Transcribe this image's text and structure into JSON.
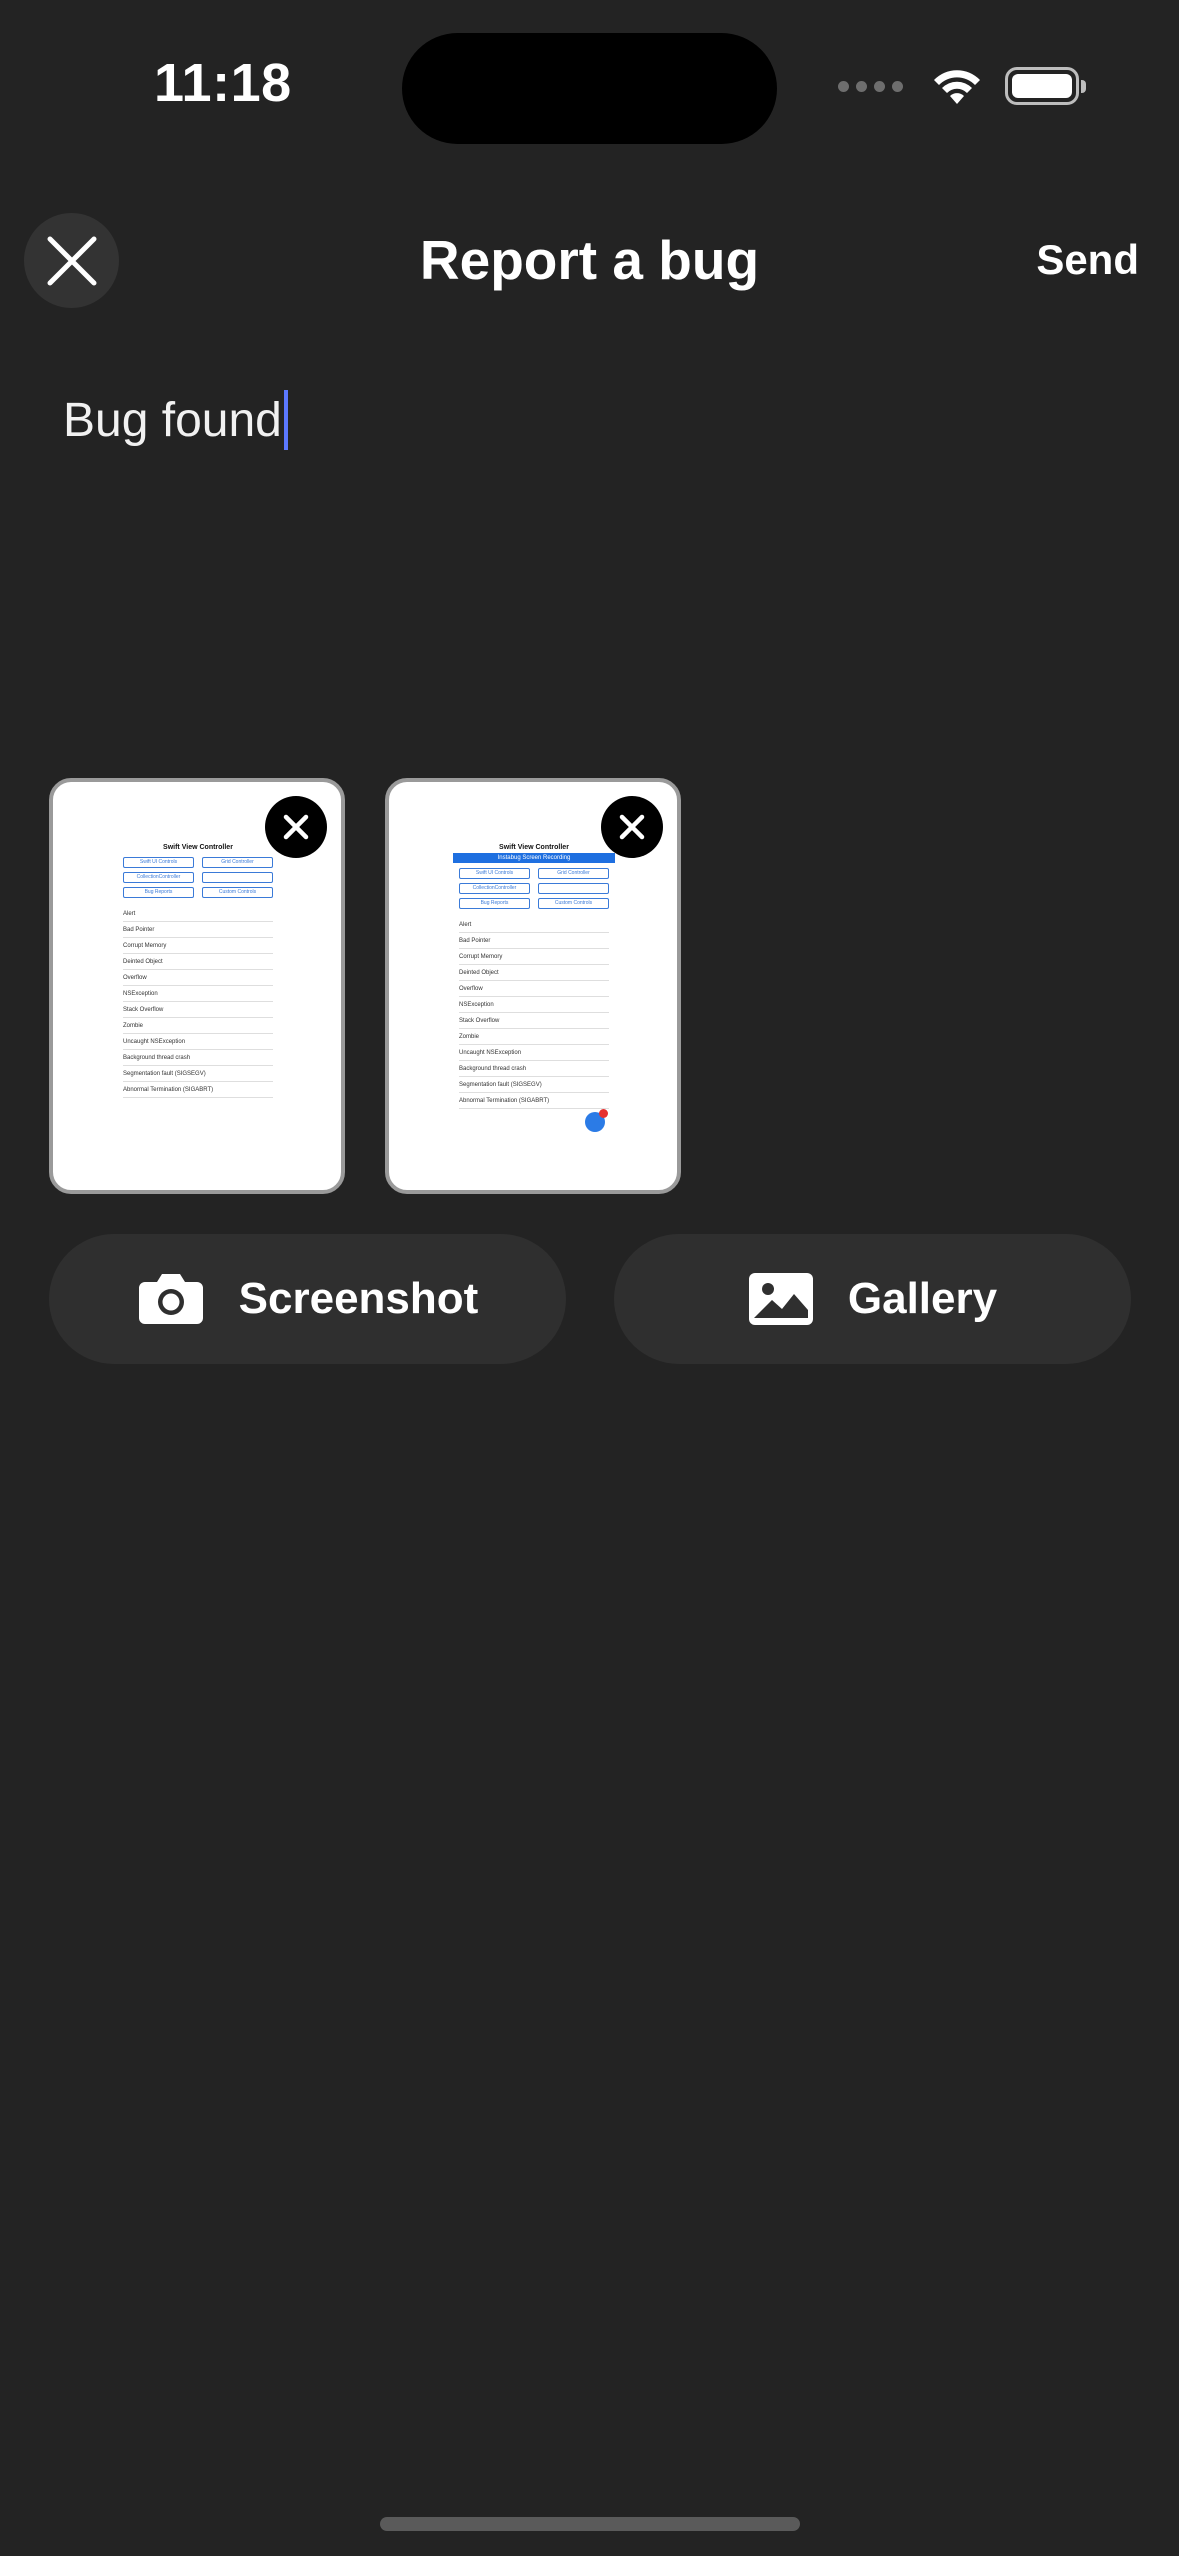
{
  "status_bar": {
    "time": "11:18",
    "icons": [
      "cellular-signal-icon",
      "wifi-icon",
      "battery-icon"
    ]
  },
  "header": {
    "title": "Report a bug",
    "send_label": "Send",
    "close_icon": "close-icon"
  },
  "input": {
    "value": "Bug found"
  },
  "attachments": [
    {
      "remove_icon": "close-icon",
      "preview": {
        "title": "Swift View Controller",
        "banner": "",
        "buttons": [
          "Swift UI Controls",
          "Grid Controller",
          "CollectionController",
          "",
          "Bug Reports",
          "Custom Controls"
        ],
        "rows": [
          "Alert",
          "Bad Pointer",
          "Corrupt Memory",
          "Deinted Object",
          "Overflow",
          "NSException",
          "Stack Overflow",
          "Zombie",
          "Uncaught NSException",
          "Background thread crash",
          "Segmentation fault (SIGSEGV)",
          "Abnormal Termination (SIGABRT)"
        ]
      }
    },
    {
      "remove_icon": "close-icon",
      "preview": {
        "title": "Swift View Controller",
        "banner": "Instabug Screen Recording",
        "buttons": [
          "Swift UI Controls",
          "Grid Controller",
          "CollectionController",
          "",
          "Bug Reports",
          "Custom Controls"
        ],
        "rows": [
          "Alert",
          "Bad Pointer",
          "Corrupt Memory",
          "Deinted Object",
          "Overflow",
          "NSException",
          "Stack Overflow",
          "Zombie",
          "Uncaught NSException",
          "Background thread crash",
          "Segmentation fault (SIGSEGV)",
          "Abnormal Termination (SIGABRT)"
        ]
      }
    }
  ],
  "actions": {
    "screenshot_label": "Screenshot",
    "screenshot_icon": "camera-icon",
    "gallery_label": "Gallery",
    "gallery_icon": "photo-icon"
  },
  "colors": {
    "background": "#232323",
    "button_bg": "#2f2f2f",
    "caret": "#5b78ff",
    "accent_blue": "#1e6fe0"
  }
}
